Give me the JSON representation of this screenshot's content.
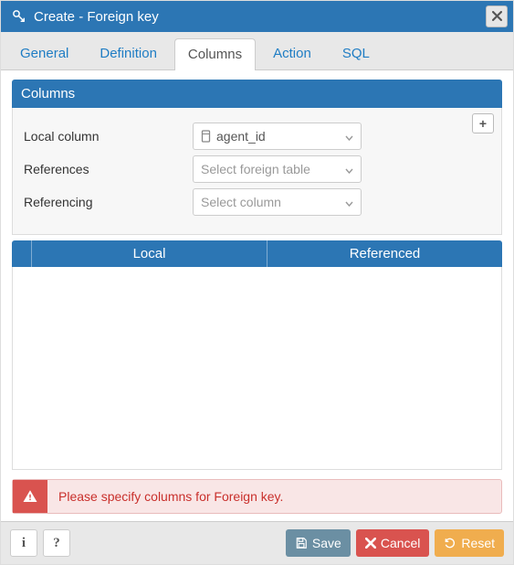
{
  "header": {
    "title": "Create - Foreign key"
  },
  "tabs": [
    {
      "label": "General",
      "active": false
    },
    {
      "label": "Definition",
      "active": false
    },
    {
      "label": "Columns",
      "active": true
    },
    {
      "label": "Action",
      "active": false
    },
    {
      "label": "SQL",
      "active": false
    }
  ],
  "section": {
    "title": "Columns"
  },
  "form": {
    "local_column": {
      "label": "Local column",
      "value": "agent_id"
    },
    "references": {
      "label": "References",
      "placeholder": "Select foreign table"
    },
    "referencing": {
      "label": "Referencing",
      "placeholder": "Select column"
    }
  },
  "table": {
    "columns": [
      "Local",
      "Referenced"
    ]
  },
  "alert": {
    "message": "Please specify columns for Foreign key."
  },
  "footer": {
    "save": "Save",
    "cancel": "Cancel",
    "reset": "Reset"
  }
}
